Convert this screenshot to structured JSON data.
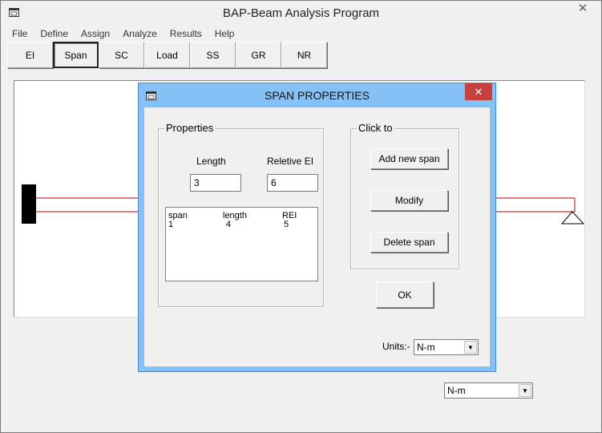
{
  "window": {
    "title": "BAP-Beam Analysis Program",
    "close_glyph": "✕"
  },
  "menu": [
    "File",
    "Define",
    "Assign",
    "Analyze",
    "Results",
    "Help"
  ],
  "toolbar": [
    "EI",
    "Span",
    "SC",
    "Load",
    "SS",
    "GR",
    "NR"
  ],
  "toolbar_active": "Span",
  "main_units": {
    "selected": "N-m"
  },
  "dialog": {
    "title": "SPAN PROPERTIES",
    "close_glyph": "✕",
    "properties": {
      "group_title": "Properties",
      "length_label": "Length",
      "rei_label": "Reletive EI",
      "length_value": "3",
      "rei_value": "6",
      "list_headers": [
        "span",
        "length",
        "REI"
      ],
      "list_rows": [
        [
          "1",
          "4",
          "5"
        ]
      ]
    },
    "click_to": {
      "group_title": "Click to",
      "add_label": "Add new span",
      "modify_label": "Modify",
      "delete_label": "Delete span"
    },
    "ok_label": "OK",
    "units_label": "Units:-",
    "units_selected": "N-m"
  },
  "colors": {
    "beam_line": "#c00000",
    "dialog_frame": "#85c1f4",
    "dialog_close": "#c74040"
  },
  "icons": {
    "app": "app-window-icon",
    "dropdown": "chevron-down-icon"
  }
}
